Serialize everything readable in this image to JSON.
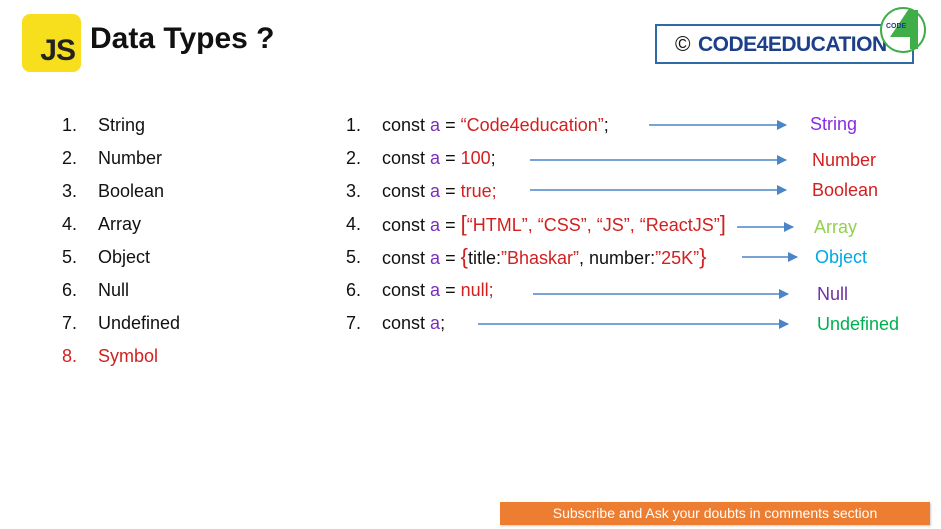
{
  "header": {
    "logo_text": "JS",
    "title": "Data Types ?",
    "brand_symbol": "©",
    "brand_name": "CODE4EDUCATION",
    "brand_logo_text": "CODE",
    "brand_logo_digit": "4"
  },
  "types": [
    {
      "number": "1.",
      "label": "String"
    },
    {
      "number": "2.",
      "label": "Number"
    },
    {
      "number": "3.",
      "label": "Boolean"
    },
    {
      "number": "4.",
      "label": "Array"
    },
    {
      "number": "5.",
      "label": "Object"
    },
    {
      "number": "6.",
      "label": "Null"
    },
    {
      "number": "7.",
      "label": "Undefined"
    },
    {
      "number": "8.",
      "label": "Symbol"
    }
  ],
  "examples": [
    {
      "number": "1.",
      "kw": "const",
      "var": "a",
      "eq": "=",
      "value": "“Code4education”",
      "end": ";",
      "result": "String",
      "result_color": "#8a2be2"
    },
    {
      "number": "2.",
      "kw": "const",
      "var": "a",
      "eq": "=",
      "value": "100",
      "end": ";",
      "result": "Number",
      "result_color": "#d21f1f"
    },
    {
      "number": "3.",
      "kw": "const",
      "var": "a",
      "eq": "=",
      "value": "true",
      "end": ";",
      "result": "Boolean",
      "result_color": "#d21f1f"
    },
    {
      "number": "4.",
      "kw": "const",
      "var": "a",
      "eq": "=",
      "value": "“HTML”, “CSS”, “JS”, “ReactJS”",
      "end": "",
      "result": "Array",
      "result_color": "#92d050"
    },
    {
      "number": "5.",
      "kw": "const",
      "var": "a",
      "eq": "=",
      "obj_key1": "title:",
      "obj_val1": "”Bhaskar”",
      "obj_sep": ", ",
      "obj_key2": "number:",
      "obj_val2": "”25K”",
      "result": "Object",
      "result_color": "#00a8e0"
    },
    {
      "number": "6.",
      "kw": "const",
      "var": "a",
      "eq": "=",
      "value": "null",
      "end": ";",
      "result": "Null",
      "result_color": "#7030a0"
    },
    {
      "number": "7.",
      "kw": "const",
      "var": "a",
      "end": ";",
      "result": "Undefined",
      "result_color": "#00b050"
    }
  ],
  "footer": {
    "banner": "Subscribe and Ask your doubts in comments section"
  },
  "colors": {
    "js_yellow": "#f7df1e",
    "arrow": "#4a86c5",
    "banner_bg": "#ed7d31",
    "brand_blue": "#1d3f8a"
  }
}
